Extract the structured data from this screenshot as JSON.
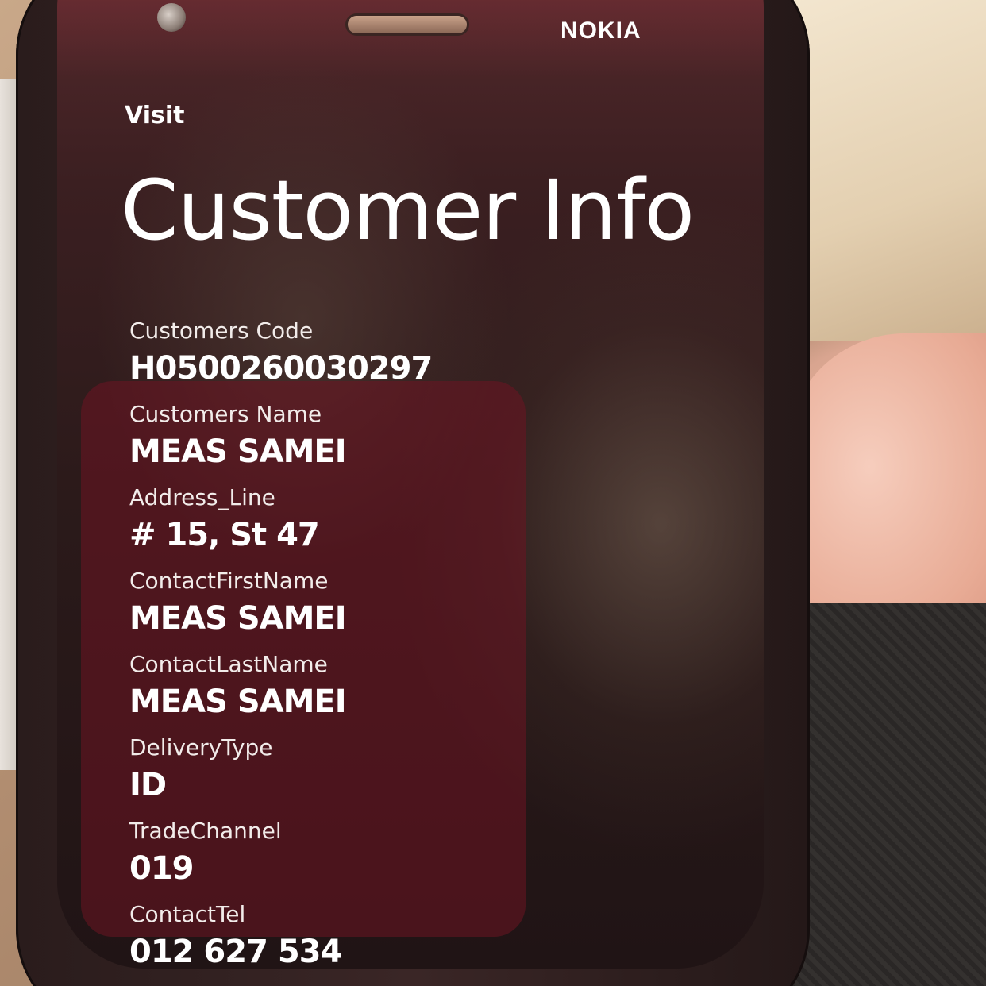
{
  "device": {
    "brand": "NOKIA"
  },
  "app": {
    "header": "Visit",
    "title": "Customer Info"
  },
  "fields": [
    {
      "label": "Customers Code",
      "value": "H0500260030297"
    },
    {
      "label": "Customers Name",
      "value": "MEAS SAMEI"
    },
    {
      "label": "Address_Line",
      "value": "# 15, St 47"
    },
    {
      "label": "ContactFirstName",
      "value": "MEAS SAMEI"
    },
    {
      "label": "ContactLastName",
      "value": "MEAS SAMEI"
    },
    {
      "label": "DeliveryType",
      "value": "ID"
    },
    {
      "label": "TradeChannel",
      "value": "019"
    },
    {
      "label": "ContactTel",
      "value": "012 627 534"
    }
  ]
}
